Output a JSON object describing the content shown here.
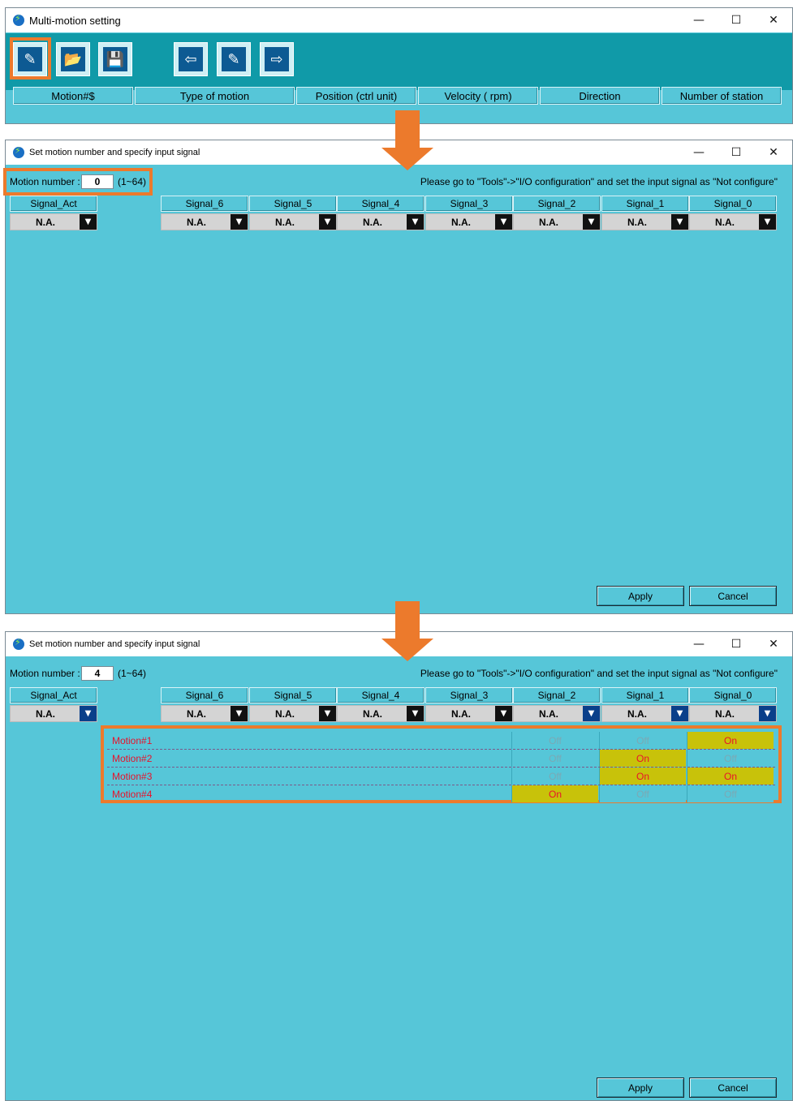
{
  "main_window": {
    "title": "Multi-motion setting",
    "sys": {
      "minimize": "—",
      "maximize": "☐",
      "close": "✕"
    },
    "toolbar": [
      {
        "name": "new-motion-button",
        "glyph": "✎"
      },
      {
        "name": "open-file-button",
        "glyph": "📂"
      },
      {
        "name": "save-file-button",
        "glyph": "💾"
      },
      {
        "name": "read-from-drive-button",
        "glyph": "⇦"
      },
      {
        "name": "write-to-drive-button",
        "glyph": "✎"
      },
      {
        "name": "export-button",
        "glyph": "⇨"
      }
    ],
    "columns": [
      "Motion#$",
      "Type of motion",
      "Position (ctrl unit)",
      "Velocity ( rpm)",
      "Direction",
      "Number of station"
    ]
  },
  "dialog1": {
    "title": "Set motion number and specify input signal",
    "motion_label": "Motion number :",
    "motion_value": "0",
    "range": "(1~64)",
    "hint": "Please go to \"Tools\"->\"I/O configuration\" and set the input signal as \"Not configure\"",
    "signal_act": {
      "label": "Signal_Act",
      "value": "N.A."
    },
    "signals": [
      {
        "label": "Signal_6",
        "value": "N.A."
      },
      {
        "label": "Signal_5",
        "value": "N.A."
      },
      {
        "label": "Signal_4",
        "value": "N.A."
      },
      {
        "label": "Signal_3",
        "value": "N.A."
      },
      {
        "label": "Signal_2",
        "value": "N.A."
      },
      {
        "label": "Signal_1",
        "value": "N.A."
      },
      {
        "label": "Signal_0",
        "value": "N.A."
      }
    ],
    "apply": "Apply",
    "cancel": "Cancel"
  },
  "dialog2": {
    "title": "Set motion number and specify input signal",
    "motion_label": "Motion number :",
    "motion_value": "4",
    "range": "(1~64)",
    "hint": "Please go to \"Tools\"->\"I/O configuration\" and set the input signal as \"Not configure\"",
    "signal_act": {
      "label": "Signal_Act",
      "value": "N.A."
    },
    "signals": [
      {
        "label": "Signal_6",
        "value": "N.A."
      },
      {
        "label": "Signal_5",
        "value": "N.A."
      },
      {
        "label": "Signal_4",
        "value": "N.A."
      },
      {
        "label": "Signal_3",
        "value": "N.A."
      },
      {
        "label": "Signal_2",
        "value": "N.A."
      },
      {
        "label": "Signal_1",
        "value": "N.A."
      },
      {
        "label": "Signal_0",
        "value": "N.A."
      }
    ],
    "motions": [
      {
        "name": "Motion#1",
        "states": [
          "Off",
          "Off",
          "On"
        ]
      },
      {
        "name": "Motion#2",
        "states": [
          "Off",
          "On",
          "Off"
        ]
      },
      {
        "name": "Motion#3",
        "states": [
          "Off",
          "On",
          "On"
        ]
      },
      {
        "name": "Motion#4",
        "states": [
          "On",
          "Off",
          "Off"
        ]
      }
    ],
    "apply": "Apply",
    "cancel": "Cancel"
  },
  "colors": {
    "accent": "#ec7a2c",
    "panel": "#56c6d8",
    "toolbar": "#109aa8",
    "on": "#c8c20a",
    "motion_text": "#e8122b"
  }
}
